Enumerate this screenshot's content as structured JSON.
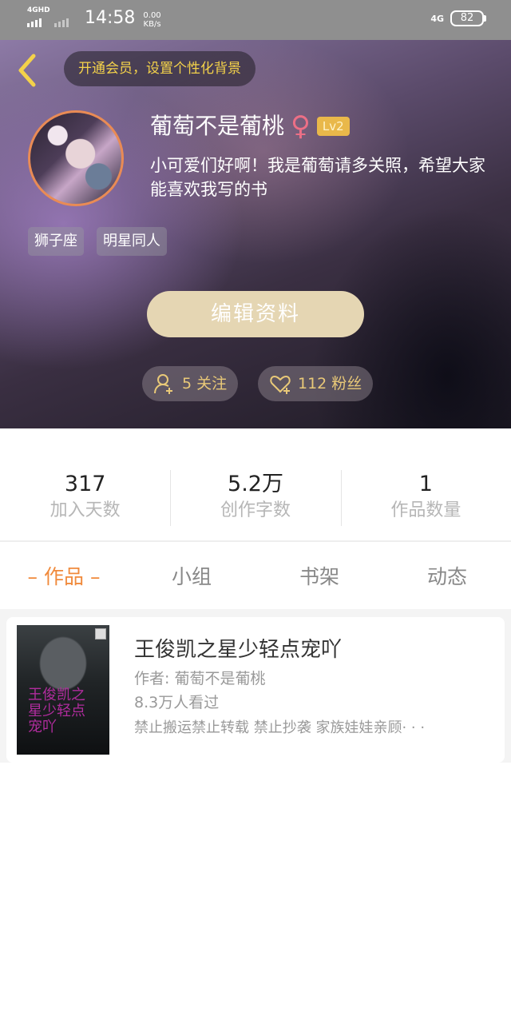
{
  "status_bar": {
    "signal1_tag": "4GHD",
    "time": "14:58",
    "speed_value": "0.00",
    "speed_unit": "KB/s",
    "network": "4G",
    "battery": "82"
  },
  "header": {
    "back_icon": "chevron-left-icon",
    "vip_banner": "开通会员，设置个性化背景",
    "username": "葡萄不是葡桃",
    "gender_icon": "♀",
    "level": "Lv2",
    "bio": "小可爱们好啊！我是葡萄请多关照，希望大家能喜欢我写的书",
    "tags": [
      "狮子座",
      "明星同人"
    ],
    "edit_button": "编辑资料",
    "follow_label": "5 关注",
    "fans_label": "112 粉丝",
    "accent_color": "#e9c978"
  },
  "stats": [
    {
      "value": "317",
      "label": "加入天数"
    },
    {
      "value": "5.2万",
      "label": "创作字数"
    },
    {
      "value": "1",
      "label": "作品数量"
    }
  ],
  "tabs": [
    {
      "label": "– 作品 –",
      "active": true
    },
    {
      "label": "小组",
      "active": false
    },
    {
      "label": "书架",
      "active": false
    },
    {
      "label": "动态",
      "active": false
    }
  ],
  "works": [
    {
      "cover_text": "王俊凯之星少轻点宠吖",
      "title": "王俊凯之星少轻点宠吖",
      "author": "作者: 葡萄不是葡桃",
      "views": "8.3万人看过",
      "description": "禁止搬运禁止转载 禁止抄袭 家族娃娃亲顾· · ·"
    }
  ]
}
